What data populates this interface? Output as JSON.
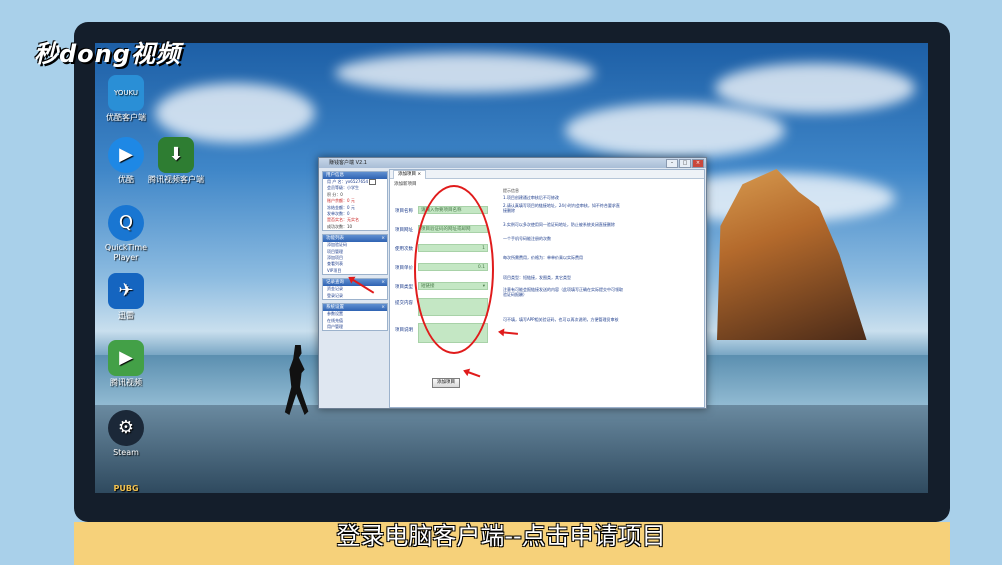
{
  "watermark": {
    "logo": "秒dong视频"
  },
  "desktop_icons": [
    {
      "label": "优酷客户端",
      "badge": "YOUKU",
      "color": "#2a8fd6"
    },
    {
      "label": "优酷",
      "badge": "▶",
      "color": "#1e88e5"
    },
    {
      "label": "腾讯视频客户端",
      "badge": "⬇",
      "color": "#2e7d32"
    },
    {
      "label": "QuickTime Player",
      "badge": "Q",
      "color": "#1976d2"
    },
    {
      "label": "迅雷",
      "badge": "✈",
      "color": "#1565c0"
    },
    {
      "label": "腾讯视频",
      "badge": "▶",
      "color": "#43a047"
    },
    {
      "label": "Steam",
      "badge": "⚙",
      "color": "#1b2838"
    },
    {
      "label": "PUBG",
      "badge": "",
      "color": ""
    }
  ],
  "window": {
    "title": "赚钱客户端 V2.1",
    "controls": {
      "minimize": "–",
      "maximize": "□",
      "close": "×"
    },
    "tab": "添加项目 ×",
    "section_title": "添加新项目",
    "user_panel": {
      "header": "用户信息",
      "rows": [
        {
          "label": "用 户 名：",
          "value": "yx6527654"
        },
        {
          "label": "会员等级：",
          "value": "小学生"
        },
        {
          "label": "积 分：",
          "value": "0"
        },
        {
          "label": "账户余额：",
          "value": "0 元"
        },
        {
          "label": "冻结金额：",
          "value": "0 元"
        },
        {
          "label": "发单次数：",
          "value": "0"
        },
        {
          "label": "是否实名：",
          "value": "无实名"
        },
        {
          "label": "成功次数：",
          "value": "10"
        }
      ]
    },
    "menu_panels": [
      {
        "header": "功能列表",
        "items": [
          "添加验证码",
          "项目管理",
          "添加项目",
          "查看列表",
          "VIP项目"
        ]
      },
      {
        "header": "记录查询",
        "items": [
          "资金记录",
          "登录记录"
        ]
      },
      {
        "header": "系统设置",
        "items": [
          "参数设置",
          "在线充值",
          "用户管理"
        ]
      }
    ],
    "form": {
      "fields": [
        {
          "label": "项目名称",
          "value": "请输入你要项目名称"
        },
        {
          "label": "项目网址",
          "value": "项目验证码的网址或邮网"
        },
        {
          "label": "使用次数",
          "value": "1"
        },
        {
          "label": "项目单价",
          "value": "0.1"
        },
        {
          "label": "项目类型",
          "value": "短链接"
        },
        {
          "label": "提交内容",
          "value": ""
        },
        {
          "label": "项目说明",
          "value": ""
        }
      ],
      "submit_label": "添加项目"
    },
    "hints": [
      "提示信息",
      "1.项目创建通过审核后不可修改",
      "2.请认真填写项目的链接地址，24小时内会审核，如不符合要求直接删除",
      "3.实例可以多次使用同一验证码地址，防止被系统关闭直接删除",
      "一个手机号码能注册的次数",
      "每次所需费用，价格为：单单价乘以实际费用",
      "项目类型：短链接，发图类，其它类型",
      "注意有可能会报链接发送的内容（此项填写正确在实际提交中可领取验证码报酬）",
      "可不填，填写APP相关验证码，也可以再次说明，方便管理员审核"
    ]
  },
  "caption": "登录电脑客户端--点击申请项目"
}
